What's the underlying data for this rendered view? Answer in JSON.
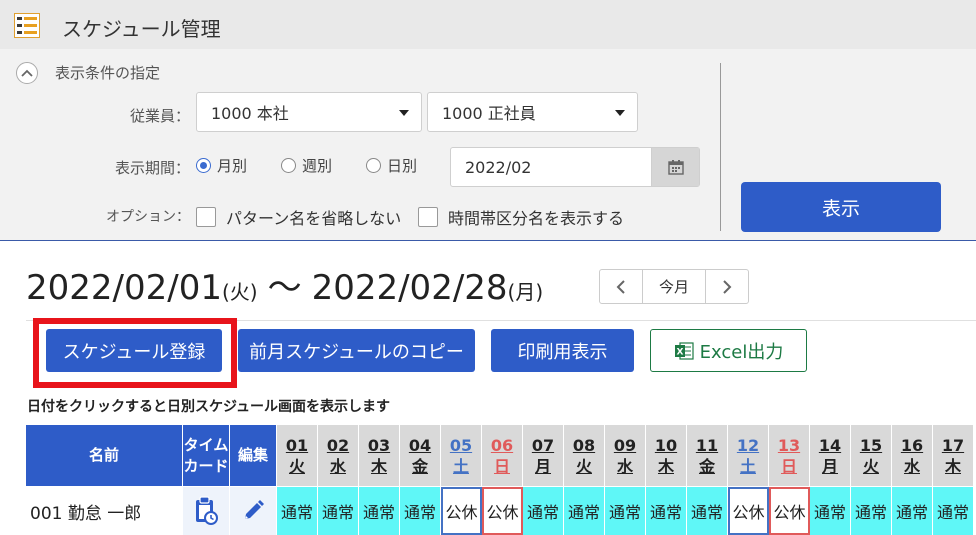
{
  "app": {
    "title": "スケジュール管理"
  },
  "filter": {
    "heading": "表示条件の指定",
    "employee_label": "従業員：",
    "employee_select1": "1000 本社",
    "employee_select2": "1000 正社員",
    "period_label": "表示期間：",
    "period_options": [
      "月別",
      "週別",
      "日別"
    ],
    "period_selected": "月別",
    "date_value": "2022/02",
    "option_label": "オプション：",
    "checkboxes": [
      {
        "label": "パターン名を省略しない",
        "checked": false
      },
      {
        "label": "時間帯区分名を表示する",
        "checked": false
      }
    ],
    "show_button": "表示"
  },
  "range": {
    "start": "2022/02/01",
    "start_dow": "(火)",
    "tilde": "〜",
    "end": "2022/02/28",
    "end_dow": "(月)",
    "today_label": "今月"
  },
  "toolbar": {
    "register": "スケジュール登録",
    "copy_prev": "前月スケジュールのコピー",
    "print_view": "印刷用表示",
    "excel": "Excel出力"
  },
  "hint": "日付をクリックすると日別スケジュール画面を表示します",
  "table": {
    "headers": {
      "name": "名前",
      "timecard": "タイム\nカード",
      "edit": "編集"
    },
    "days": [
      {
        "d": "01",
        "w": "火",
        "t": "weekday"
      },
      {
        "d": "02",
        "w": "水",
        "t": "weekday"
      },
      {
        "d": "03",
        "w": "木",
        "t": "weekday"
      },
      {
        "d": "04",
        "w": "金",
        "t": "weekday"
      },
      {
        "d": "05",
        "w": "土",
        "t": "sat"
      },
      {
        "d": "06",
        "w": "日",
        "t": "sun"
      },
      {
        "d": "07",
        "w": "月",
        "t": "weekday"
      },
      {
        "d": "08",
        "w": "火",
        "t": "weekday"
      },
      {
        "d": "09",
        "w": "水",
        "t": "weekday"
      },
      {
        "d": "10",
        "w": "木",
        "t": "weekday"
      },
      {
        "d": "11",
        "w": "金",
        "t": "weekday"
      },
      {
        "d": "12",
        "w": "土",
        "t": "sat"
      },
      {
        "d": "13",
        "w": "日",
        "t": "sun"
      },
      {
        "d": "14",
        "w": "月",
        "t": "weekday"
      },
      {
        "d": "15",
        "w": "火",
        "t": "weekday"
      },
      {
        "d": "16",
        "w": "水",
        "t": "weekday"
      },
      {
        "d": "17",
        "w": "木",
        "t": "weekday"
      }
    ],
    "rows": [
      {
        "name": "001 勤怠 一郎",
        "cells": [
          "通常",
          "通常",
          "通常",
          "通常",
          "公休",
          "公休",
          "通常",
          "通常",
          "通常",
          "通常",
          "通常",
          "公休",
          "公休",
          "通常",
          "通常",
          "通常",
          "通常"
        ]
      }
    ]
  },
  "colors": {
    "primary": "#2e5cc8",
    "highlight": "#e8141b",
    "work_cell": "#5ff7f7",
    "saturday": "#4472c4",
    "sunday": "#e05a5a"
  }
}
